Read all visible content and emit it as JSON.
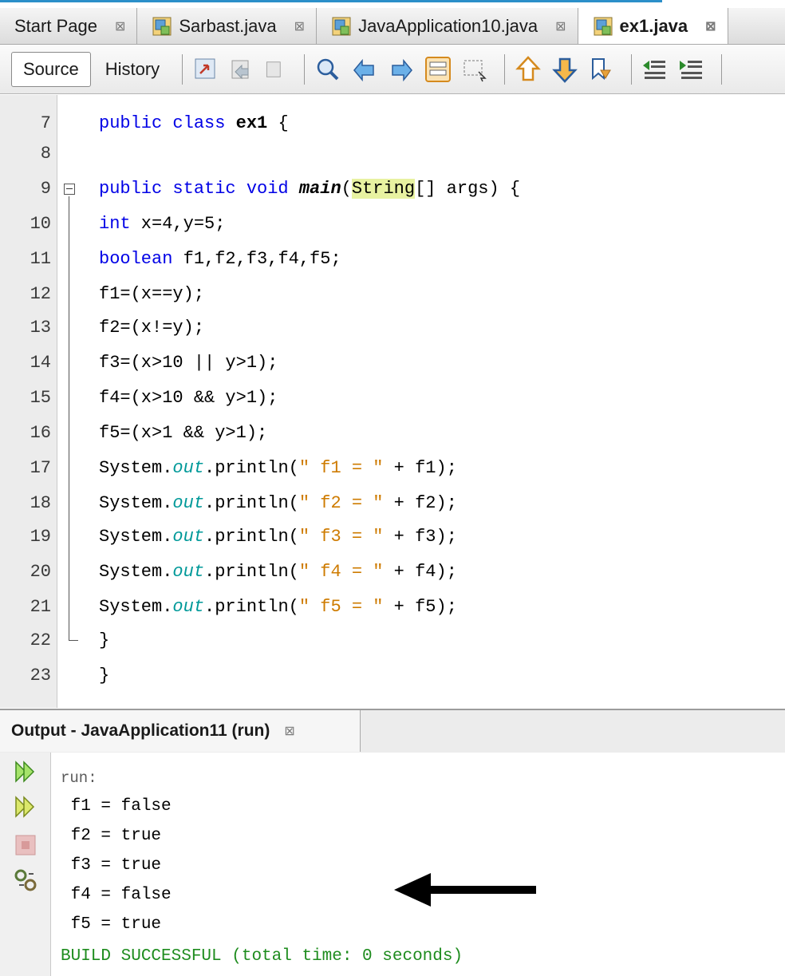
{
  "tabs": [
    {
      "label": "Start Page",
      "close": "⊠"
    },
    {
      "label": "Sarbast.java",
      "close": "⊠"
    },
    {
      "label": "JavaApplication10.java",
      "close": "⊠"
    },
    {
      "label": "ex1.java",
      "close": "⊠",
      "active": true
    }
  ],
  "toolbar": {
    "source_label": "Source",
    "history_label": "History"
  },
  "editor": {
    "lines": [
      {
        "num": "7"
      },
      {
        "num": "8"
      },
      {
        "num": "9"
      },
      {
        "num": "10"
      },
      {
        "num": "11"
      },
      {
        "num": "12"
      },
      {
        "num": "13"
      },
      {
        "num": "14"
      },
      {
        "num": "15"
      },
      {
        "num": "16"
      },
      {
        "num": "17"
      },
      {
        "num": "18"
      },
      {
        "num": "19"
      },
      {
        "num": "20"
      },
      {
        "num": "21"
      },
      {
        "num": "22"
      },
      {
        "num": "23"
      }
    ],
    "code": {
      "l7_kw": "public class",
      "l7_name": "ex1",
      "l7_rest": " {",
      "l9_kw": "public static void",
      "l9_method": "main",
      "l9_type": "String",
      "l9_rest": "[] args) {",
      "l10_kw": "int",
      "l10_rest": " x=4,y=5;",
      "l11_kw": "boolean",
      "l11_rest": " f1,f2,f3,f4,f5;",
      "l12": "f1=(x==y);",
      "l13": "f2=(x!=y);",
      "l14": "f3=(x>10 || y>1);",
      "l15": "f4=(x>10 && y>1);",
      "l16": "f5=(x>1 && y>1);",
      "sys": "System.",
      "out": "out",
      "println": ".println(",
      "s17": "\" f1 = \"",
      "r17": " + f1);",
      "s18": "\" f2 = \"",
      "r18": " + f2);",
      "s19": "\" f3 = \"",
      "r19": " + f3);",
      "s20": "\" f4 = \"",
      "r20": " + f4);",
      "s21": "\" f5 = \"",
      "r21": " + f5);",
      "l22": "}",
      "l23": "}"
    }
  },
  "output": {
    "tab_label": "Output - JavaApplication11 (run)",
    "tab_close": "⊠",
    "lines": [
      "run:",
      " f1 = false",
      " f2 = true",
      " f3 = true",
      " f4 = false",
      " f5 = true"
    ],
    "build": "BUILD SUCCESSFUL (total time: 0 seconds)"
  },
  "colors": {
    "keyword": "#0000e6",
    "string": "#ce7b00",
    "field": "#009999",
    "build": "#1e8c1e"
  }
}
